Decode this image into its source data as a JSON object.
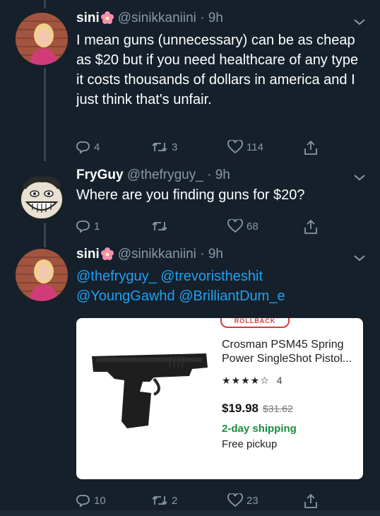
{
  "tweets": [
    {
      "name": "sini",
      "handle": "@sinikkaniini",
      "sep": "·",
      "time": "9h",
      "text": "I mean guns (unnecessary) can be as cheap as $20 but if you need healthcare of any type it costs thousands of dollars in america and I just think that's unfair.",
      "replies": "4",
      "retweets": "3",
      "likes": "114"
    },
    {
      "name": "FryGuy",
      "handle": "@thefryguy_",
      "sep": "·",
      "time": "9h",
      "text": "Where are you finding guns for $20?",
      "replies": "1",
      "retweets": "",
      "likes": "68"
    },
    {
      "name": "sini",
      "handle": "@sinikkaniini",
      "sep": "·",
      "time": "9h",
      "mentions_line1": "@thefryguy_ @trevoristheshit",
      "mentions_line2": "@YoungGawhd @BrilliantDum_e",
      "replies": "10",
      "retweets": "2",
      "likes": "23"
    }
  ],
  "product_card": {
    "badge": "ROLLBACK",
    "title": "Crosman PSM45 Spring Power SingleShot Pistol...",
    "stars": "★★★★☆",
    "rating_count": "4",
    "price": "$19.98",
    "old_price": "$31.62",
    "shipping": "2-day shipping",
    "pickup": "Free pickup"
  },
  "icons": {
    "reply": "reply-icon",
    "retweet": "retweet-icon",
    "like": "heart-icon",
    "share": "share-icon",
    "caret": "chevron-down-icon"
  },
  "colors": {
    "background": "#15202b",
    "secondary_text": "#8899a6",
    "link": "#1da1f2",
    "shipping_green": "#1a8f3c",
    "rollback_red": "#d93a3a"
  }
}
